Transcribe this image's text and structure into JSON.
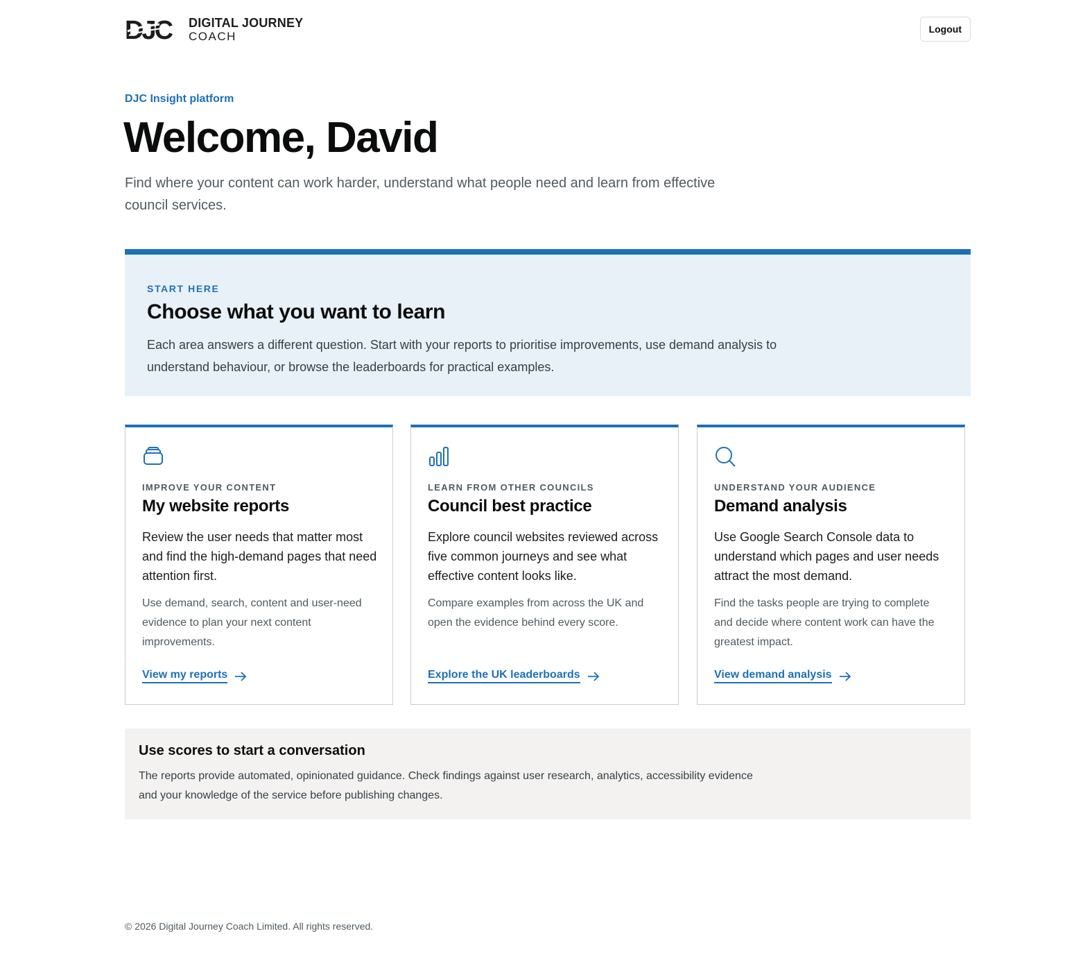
{
  "header": {
    "logo_mark": "DJC",
    "logo_line1": "DIGITAL JOURNEY",
    "logo_line2": "COACH",
    "logout_label": "Logout"
  },
  "hero": {
    "eyebrow": "DJC Insight platform",
    "title": "Welcome, David",
    "intro": "Find where your content can work harder, understand what people need and learn from effective council services."
  },
  "start_panel": {
    "eyebrow": "START HERE",
    "title": "Choose what you want to learn",
    "body": "Each area answers a different question. Start with your reports to prioritise improvements, use demand analysis to understand behaviour, or browse the leaderboards for practical examples."
  },
  "cards": [
    {
      "icon": "stack-icon",
      "eyebrow": "IMPROVE YOUR CONTENT",
      "title": "My website reports",
      "lead": "Review the user needs that matter most and find the high-demand pages that need attention first.",
      "detail": "Use demand, search, content and user-need evidence to plan your next content improvements.",
      "link": "View my reports"
    },
    {
      "icon": "bar-chart-icon",
      "eyebrow": "LEARN FROM OTHER COUNCILS",
      "title": "Council best practice",
      "lead": "Explore council websites reviewed across five common journeys and see what effective content looks like.",
      "detail": "Compare examples from across the UK and open the evidence behind every score.",
      "link": "Explore the UK leaderboards"
    },
    {
      "icon": "search-icon",
      "eyebrow": "UNDERSTAND YOUR AUDIENCE",
      "title": "Demand analysis",
      "lead": "Use Google Search Console data to understand which pages and user needs attract the most demand.",
      "detail": "Find the tasks people are trying to complete and decide where content work can have the greatest impact.",
      "link": "View demand analysis"
    }
  ],
  "note": {
    "title": "Use scores to start a conversation",
    "body": "The reports provide automated, opinionated guidance. Check findings against user research, analytics, accessibility evidence and your knowledge of the service before publishing changes."
  },
  "footer": {
    "copyright": "© 2026 Digital Journey Coach Limited. All rights reserved."
  },
  "colors": {
    "accent": "#1d70b8",
    "panel_bg": "#e8f1f8",
    "note_bg": "#f3f2f1",
    "text": "#0b0c0c",
    "muted": "#505a5f"
  }
}
